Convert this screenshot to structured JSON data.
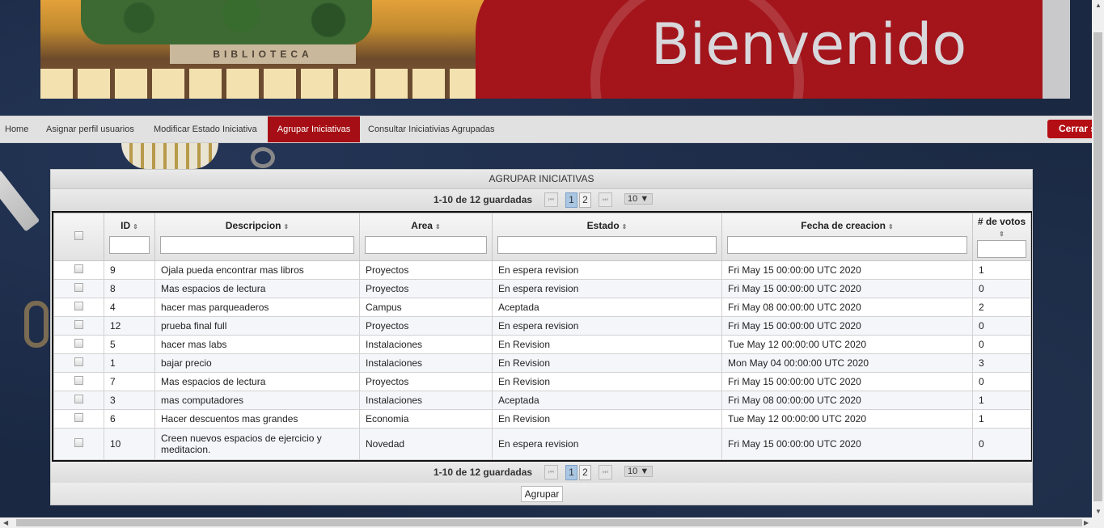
{
  "banner": {
    "title": "Bienvenido",
    "sign": "BIBLIOTECA"
  },
  "nav": {
    "items": [
      {
        "label": "Home"
      },
      {
        "label": "Asignar perfil usuarios"
      },
      {
        "label": "Modificar Estado Iniciativa"
      },
      {
        "label": "Agrupar Iniciativas"
      },
      {
        "label": "Consultar Iniciativias Agrupadas"
      }
    ],
    "active": "Agrupar Iniciativas",
    "logout_label": "Cerrar s"
  },
  "panel": {
    "title": "AGRUPAR INICIATIVAS",
    "paginator": {
      "report": "1-10 de 12 guardadas",
      "pages": [
        "1",
        "2"
      ],
      "current_page": "1",
      "rows_per_page": "10"
    },
    "columns": [
      "ID",
      "Descripcion",
      "Area",
      "Estado",
      "Fecha de creacion",
      "# de votos"
    ],
    "rows": [
      {
        "id": "9",
        "descripcion": "Ojala pueda encontrar mas libros",
        "area": "Proyectos",
        "estado": "En espera revision",
        "fecha": "Fri May 15 00:00:00 UTC 2020",
        "votos": "1"
      },
      {
        "id": "8",
        "descripcion": "Mas espacios de lectura",
        "area": "Proyectos",
        "estado": "En espera revision",
        "fecha": "Fri May 15 00:00:00 UTC 2020",
        "votos": "0"
      },
      {
        "id": "4",
        "descripcion": "hacer mas parqueaderos",
        "area": "Campus",
        "estado": "Aceptada",
        "fecha": "Fri May 08 00:00:00 UTC 2020",
        "votos": "2"
      },
      {
        "id": "12",
        "descripcion": "prueba final full",
        "area": "Proyectos",
        "estado": "En espera revision",
        "fecha": "Fri May 15 00:00:00 UTC 2020",
        "votos": "0"
      },
      {
        "id": "5",
        "descripcion": "hacer mas labs",
        "area": "Instalaciones",
        "estado": "En Revision",
        "fecha": "Tue May 12 00:00:00 UTC 2020",
        "votos": "0"
      },
      {
        "id": "1",
        "descripcion": "bajar precio",
        "area": "Instalaciones",
        "estado": "En Revision",
        "fecha": "Mon May 04 00:00:00 UTC 2020",
        "votos": "3"
      },
      {
        "id": "7",
        "descripcion": "Mas espacios de lectura",
        "area": "Proyectos",
        "estado": "En Revision",
        "fecha": "Fri May 15 00:00:00 UTC 2020",
        "votos": "0"
      },
      {
        "id": "3",
        "descripcion": "mas computadores",
        "area": "Instalaciones",
        "estado": "Aceptada",
        "fecha": "Fri May 08 00:00:00 UTC 2020",
        "votos": "1"
      },
      {
        "id": "6",
        "descripcion": "Hacer descuentos mas grandes",
        "area": "Economia",
        "estado": "En Revision",
        "fecha": "Tue May 12 00:00:00 UTC 2020",
        "votos": "1"
      },
      {
        "id": "10",
        "descripcion": "Creen nuevos espacios de ejercicio y meditacion.",
        "area": "Novedad",
        "estado": "En espera revision",
        "fecha": "Fri May 15 00:00:00 UTC 2020",
        "votos": "0"
      }
    ],
    "submit_label": "Agrupar"
  },
  "colors": {
    "accent_red": "#a50e14",
    "page_bg": "#1a2842"
  }
}
